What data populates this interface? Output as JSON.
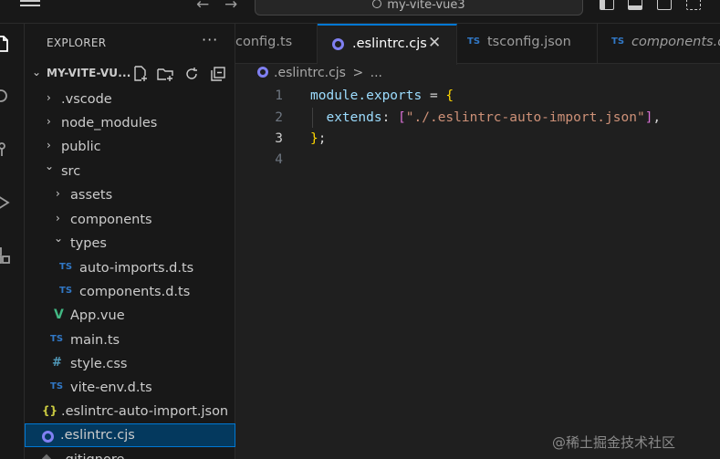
{
  "titlebar": {
    "search_text": "my-vite-vue3"
  },
  "explorer": {
    "title": "EXPLORER",
    "more": "···",
    "root_folder": "MY-VITE-VU...",
    "tree": [
      {
        "label": ".vscode",
        "kind": "folder-collapsed",
        "depth": 0
      },
      {
        "label": "node_modules",
        "kind": "folder-collapsed",
        "depth": 0
      },
      {
        "label": "public",
        "kind": "folder-collapsed",
        "depth": 0
      },
      {
        "label": "src",
        "kind": "folder-expanded",
        "depth": 0
      },
      {
        "label": "assets",
        "kind": "folder-collapsed",
        "depth": 1
      },
      {
        "label": "components",
        "kind": "folder-collapsed",
        "depth": 1
      },
      {
        "label": "types",
        "kind": "folder-expanded",
        "depth": 1
      },
      {
        "label": "auto-imports.d.ts",
        "kind": "ts",
        "badge": "TS",
        "depth": 2
      },
      {
        "label": "components.d.ts",
        "kind": "ts",
        "badge": "TS",
        "depth": 2
      },
      {
        "label": "App.vue",
        "kind": "vue",
        "badge": "V",
        "depth": 1
      },
      {
        "label": "main.ts",
        "kind": "ts",
        "badge": "TS",
        "depth": 1
      },
      {
        "label": "style.css",
        "kind": "css",
        "badge": "#",
        "depth": 1
      },
      {
        "label": "vite-env.d.ts",
        "kind": "ts",
        "badge": "TS",
        "depth": 1
      },
      {
        "label": ".eslintrc-auto-import.json",
        "kind": "json",
        "badge": "{}",
        "depth": 0
      },
      {
        "label": ".eslintrc.cjs",
        "kind": "eslint",
        "depth": 0,
        "selected": true
      },
      {
        "label": ".gitignore",
        "kind": "git",
        "depth": 0
      }
    ]
  },
  "tabs": [
    {
      "label": "config.ts",
      "active": false
    },
    {
      "label": ".eslintrc.cjs",
      "active": true,
      "close": "✕"
    },
    {
      "label": "tsconfig.json",
      "badge": "TS",
      "active": false
    },
    {
      "label": "components.d.ts",
      "badge": "TS",
      "active": false
    }
  ],
  "breadcrumb": {
    "file": ".eslintrc.cjs",
    "sep": ">",
    "rest": "..."
  },
  "editor": {
    "line_numbers": [
      "1",
      "2",
      "3",
      "4"
    ],
    "current_line": 3,
    "lines": [
      {
        "a": "module.exports",
        "b": " = ",
        "c": "{"
      },
      {
        "a": "  extends",
        "b": ": ",
        "c": "[",
        "d": "\"./.eslintrc-auto-import.json\"",
        "e": "]",
        "f": ","
      },
      {
        "a": "}",
        "b": ";"
      }
    ]
  },
  "watermark": "@稀土掘金技术社区",
  "colors": {
    "accent": "#0078d4",
    "ts": "#3178c6",
    "vue": "#42b883",
    "eslint": "#8080f2"
  }
}
